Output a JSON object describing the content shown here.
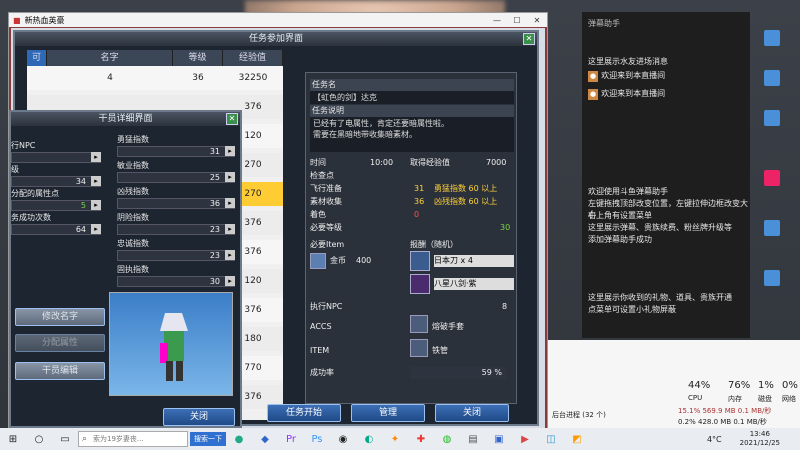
{
  "game": {
    "window_title": "新热血英豪",
    "quest_panel_title": "任务参加界面",
    "detail_panel_title": "任务详情",
    "tab_label": "可",
    "columns": [
      "名字",
      "等级",
      "经验值"
    ],
    "rows": [
      {
        "id": "4",
        "level": "36",
        "exp": "32250"
      },
      {
        "id": "",
        "level": "",
        "exp": "376"
      },
      {
        "id": "",
        "level": "",
        "exp": "120"
      },
      {
        "id": "",
        "level": "",
        "exp": "270"
      },
      {
        "id": "",
        "level": "",
        "exp": "270"
      },
      {
        "id": "",
        "level": "",
        "exp": "376"
      },
      {
        "id": "",
        "level": "",
        "exp": "376"
      },
      {
        "id": "",
        "level": "",
        "exp": "120"
      },
      {
        "id": "",
        "level": "",
        "exp": "376"
      },
      {
        "id": "",
        "level": "",
        "exp": "180"
      },
      {
        "id": "",
        "level": "",
        "exp": "770"
      },
      {
        "id": "",
        "level": "",
        "exp": "376"
      }
    ],
    "detail": {
      "name_label": "任务名",
      "name_value": "【虹色的剑】达克",
      "desc_label": "任务说明",
      "desc_lines": [
        "已经有了电属性，肯定还要暗属性啦。",
        "需要在黑暗地带收集暗素材。"
      ],
      "time_label": "时间",
      "time_value": "10:00",
      "exp_gain_label": "取得经验值",
      "exp_gain_value": "7000",
      "checkpoint_label": "检查点",
      "checks": [
        {
          "label": "飞行准备",
          "a": "31",
          "b": "勇猛指数 60 以上",
          "color": "yellow"
        },
        {
          "label": "素材收集",
          "a": "36",
          "b": "凶残指数 60 以上",
          "color": "yellow"
        },
        {
          "label": "着色",
          "a": "0",
          "b": "",
          "color": "red"
        },
        {
          "label": "必要等级",
          "a": "",
          "b": "30",
          "color": "green"
        }
      ],
      "item_label": "必要Item",
      "gold_label": "金币",
      "gold_value": "400",
      "reward_label": "报酬（随机）",
      "reward_items": [
        "日本刀 x 4",
        "八星八剑·紫"
      ],
      "npc_label": "执行NPC",
      "npc_value": "8",
      "accs_label": "ACCS",
      "accs_value": "熔破手套",
      "item2_label": "ITEM",
      "item2_value": "铁管",
      "success_label": "成功率",
      "success_value": "59 %"
    },
    "buttons": {
      "start": "任务开始",
      "manage": "管理",
      "close": "关闭"
    },
    "sub_panel": {
      "title": "干员详细界面",
      "left_labels": [
        "行NPC",
        "级",
        "分配的属性点",
        "务成功次数"
      ],
      "left_values": [
        "",
        "34",
        "5",
        "64"
      ],
      "stats": [
        {
          "label": "勇猛指数",
          "value": "31"
        },
        {
          "label": "敏业指数",
          "value": "25"
        },
        {
          "label": "凶残指数",
          "value": "36"
        },
        {
          "label": "阴险指数",
          "value": "23"
        },
        {
          "label": "忠诚指数",
          "value": "23"
        },
        {
          "label": "固执指数",
          "value": "30"
        }
      ],
      "btn_rename": "修改名字",
      "btn_attr": "分配属性",
      "btn_edit": "干员编辑",
      "btn_close": "关闭"
    }
  },
  "chat": {
    "title": "弹幕助手",
    "messages": [
      "这里展示水友进场消息",
      "欢迎来到本直播间",
      "欢迎来到本直播间",
      "欢迎使用斗鱼弹幕助手",
      "左键拖拽顶部改变位置，左键拉伸边框改变大小",
      "右上角有设置菜单",
      "这里展示弹幕、贵族续费、粉丝牌升级等",
      "添加弹幕助手成功",
      "这里展示你收到的礼物、道具、贵族开通",
      "点菜单可设置小礼物屏蔽"
    ]
  },
  "taskmgr": {
    "cpu": "44%",
    "mem": "76%",
    "col1": "1%",
    "col2": "0%",
    "cpu_label": "CPU",
    "mem_label": "内存",
    "disk_label": "磁盘",
    "net_label": "网络",
    "row1": "15.1%   569.9 MB   0.1 MB/秒",
    "row2": "0.2%   428.0 MB   0.1 MB/秒",
    "proc_label": "后台进程 (32 个)"
  },
  "taskbar": {
    "search_placeholder": "索为19岁妻丧...",
    "search_button": "搜索一下",
    "temp": "4°C",
    "time": "13:46",
    "date": "2021/12/25"
  }
}
